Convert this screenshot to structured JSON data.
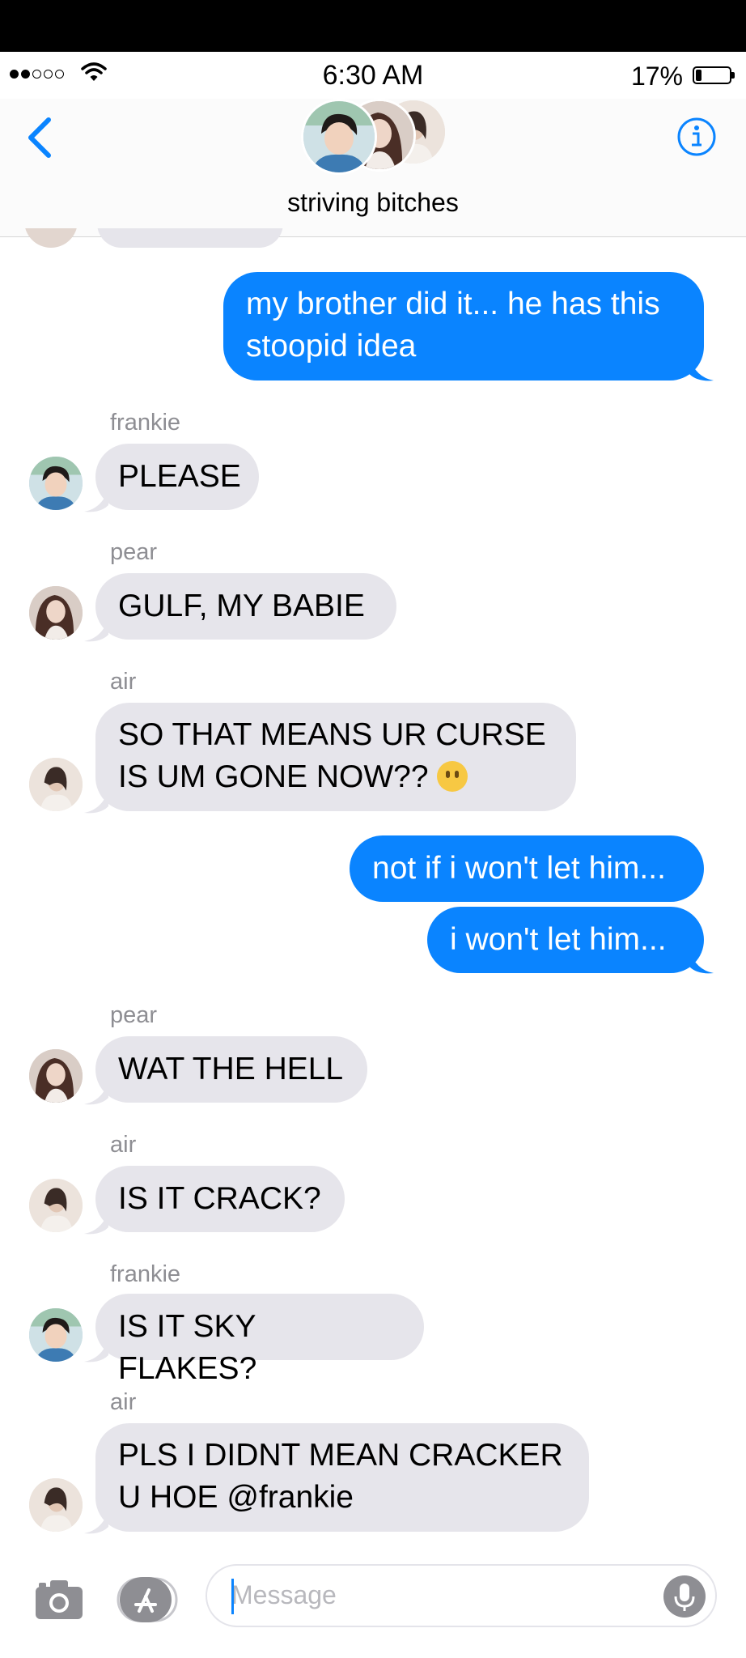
{
  "status": {
    "time": "6:30 AM",
    "battery": "17%",
    "battery_level": 0.17
  },
  "header": {
    "title": "striving bitches"
  },
  "colors": {
    "outgoing": "#0a84ff",
    "incoming": "#e6e5eb",
    "accent": "#0a84ff"
  },
  "messages": [
    {
      "direction": "out",
      "text": "my brother did it... he has this\nstoopid idea"
    },
    {
      "sender": "frankie",
      "text": "PLEASE"
    },
    {
      "sender": "pear",
      "text": "GULF, MY BABIE"
    },
    {
      "sender": "air",
      "text": "SO THAT MEANS UR CURSE\nIS UM GONE NOW??",
      "emoji": "face-without-mouth"
    },
    {
      "direction": "out",
      "text": "not if i won't let him..."
    },
    {
      "direction": "out",
      "text": "i won't let him..."
    },
    {
      "sender": "pear",
      "text": "WAT THE HELL"
    },
    {
      "sender": "air",
      "text": "IS IT CRACK?"
    },
    {
      "sender": "frankie",
      "text": "IS IT SKY FLAKES?"
    },
    {
      "sender": "air",
      "text": "PLS I DIDNT MEAN CRACKER\nU HOE @frankie"
    }
  ],
  "composer": {
    "placeholder": "Message"
  }
}
